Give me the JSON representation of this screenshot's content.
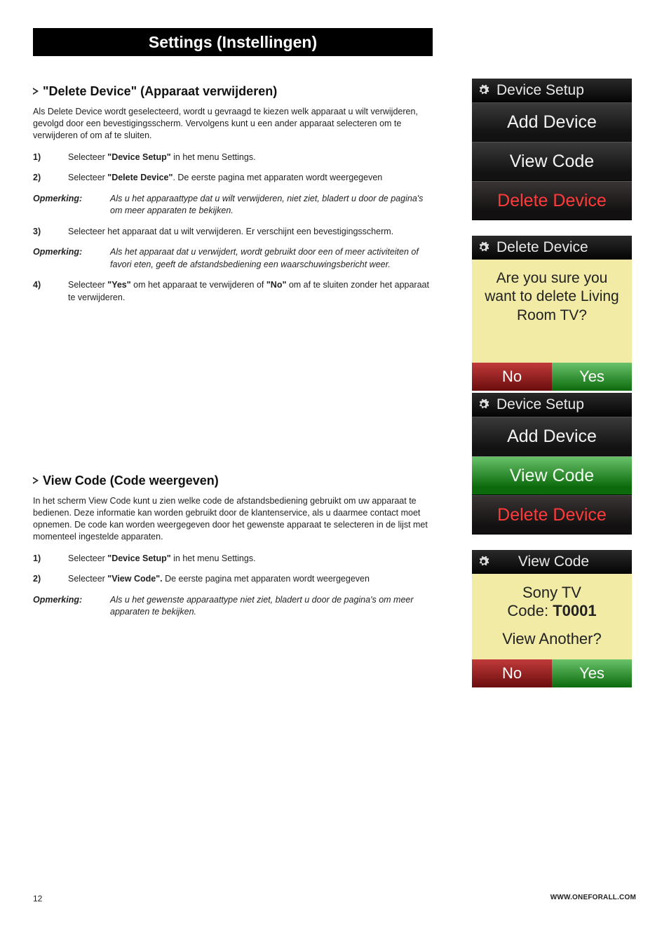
{
  "page_title": "Settings (Instellingen)",
  "section1": {
    "heading": "\"Delete Device\" (Apparaat verwijderen)",
    "intro": "Als Delete Device wordt geselecteerd, wordt u gevraagd te kiezen welk apparaat u wilt verwijderen, gevolgd door een bevestigingsscherm. Vervolgens kunt u een ander apparaat selecteren om te verwijderen of om af te sluiten.",
    "steps": [
      {
        "n": "1)",
        "pre": "Selecteer ",
        "bold": "\"Device Setup\"",
        "post": " in het menu Settings."
      },
      {
        "n": "2)",
        "pre": "Selecteer ",
        "bold": "\"Delete Device\"",
        "post": ". De eerste pagina met apparaten wordt weergegeven"
      }
    ],
    "note1": {
      "label": "Opmerking:",
      "text": "Als u het apparaattype dat u wilt verwijderen, niet ziet, bladert u door de pagina's om meer apparaten te bekijken."
    },
    "step3": {
      "n": "3)",
      "text": "Selecteer het apparaat dat u wilt verwijderen. Er verschijnt een bevestigingsscherm."
    },
    "note2": {
      "label": "Opmerking:",
      "text": "Als het apparaat dat u verwijdert, wordt gebruikt door een of meer activiteiten of favori eten, geeft de afstandsbediening een waarschuwingsbericht weer."
    },
    "step4": {
      "n": "4)",
      "pre": "Selecteer ",
      "bold1": "\"Yes\"",
      "mid": " om het apparaat te verwijderen of ",
      "bold2": "\"No\"",
      "post": " om af te sluiten zonder het apparaat te verwijderen."
    }
  },
  "section2": {
    "heading": "View Code (Code weergeven)",
    "intro": "In het scherm View Code kunt u zien welke code de afstandsbediening gebruikt om uw apparaat te bedienen. Deze informatie kan worden gebruikt door de klantenservice, als u daarmee contact moet opnemen. De code kan worden weergegeven door het gewenste apparaat te selecteren in de lijst met momenteel ingestelde apparaten.",
    "steps": [
      {
        "n": "1)",
        "pre": "Selecteer ",
        "bold": "\"Device Setup\"",
        "post": " in het menu Settings."
      },
      {
        "n": "2)",
        "pre": "Selecteer ",
        "bold": "\"View Code\".",
        "post": " De eerste pagina met apparaten wordt weergegeven"
      }
    ],
    "note1": {
      "label": "Opmerking:",
      "text": "Als u het gewenste apparaattype niet ziet, bladert u door de pagina's om meer apparaten te bekijken."
    }
  },
  "screens": {
    "s1": {
      "header": "Device Setup",
      "items": [
        "Add Device",
        "View Code",
        "Delete Device"
      ],
      "highlight_index": -1,
      "red_index": 2
    },
    "s2": {
      "header": "Delete Device",
      "question": "Are you sure you want to delete Living Room TV?",
      "no": "No",
      "yes": "Yes"
    },
    "s3": {
      "header": "Device Setup",
      "items": [
        "Add Device",
        "View Code",
        "Delete Device"
      ],
      "highlight_index": 1,
      "red_index": 2
    },
    "s4": {
      "header": "View Code",
      "line1": "Sony TV",
      "code_label": "Code: ",
      "code": "T0001",
      "sub": "View Another?",
      "no": "No",
      "yes": "Yes"
    }
  },
  "footer": {
    "page": "12",
    "url": "WWW.ONEFORALL.COM"
  }
}
